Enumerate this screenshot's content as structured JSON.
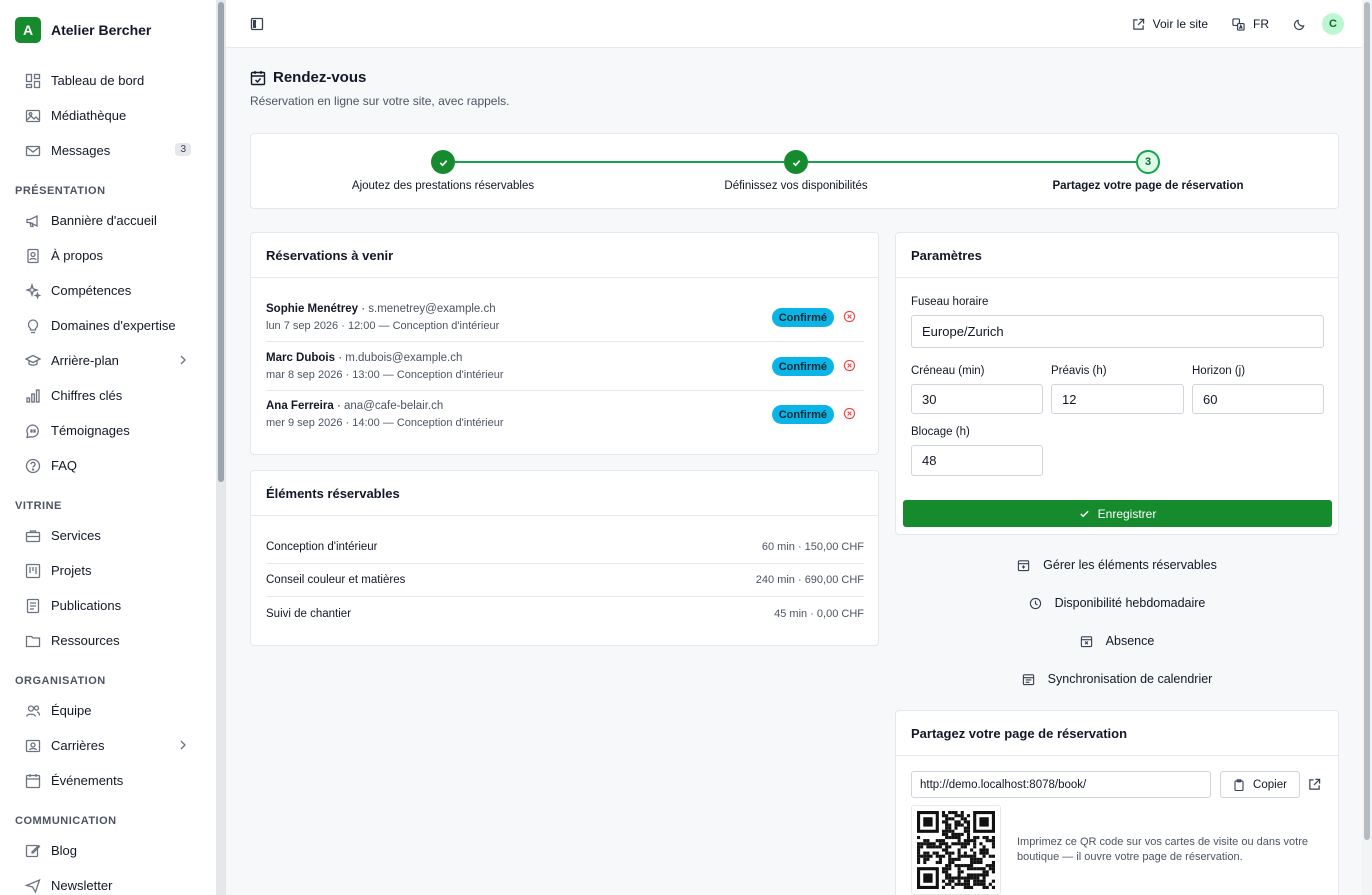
{
  "brand": {
    "initial": "A",
    "name": "Atelier Bercher"
  },
  "sidebar": {
    "items_main": [
      {
        "label": "Tableau de bord",
        "icon": "dashboard-icon"
      },
      {
        "label": "Médiathèque",
        "icon": "image-icon"
      },
      {
        "label": "Messages",
        "icon": "mail-icon",
        "badge": "3"
      }
    ],
    "section_presentation": "PRÉSENTATION",
    "items_presentation": [
      {
        "label": "Bannière d'accueil",
        "icon": "megaphone-icon"
      },
      {
        "label": "À propos",
        "icon": "contact-icon"
      },
      {
        "label": "Compétences",
        "icon": "sparkles-icon"
      },
      {
        "label": "Domaines d'expertise",
        "icon": "lightbulb-icon"
      },
      {
        "label": "Arrière-plan",
        "icon": "graduation-icon",
        "chevron": true
      },
      {
        "label": "Chiffres clés",
        "icon": "bar-chart-icon"
      },
      {
        "label": "Témoignages",
        "icon": "quote-icon"
      },
      {
        "label": "FAQ",
        "icon": "help-icon"
      }
    ],
    "section_vitrine": "VITRINE",
    "items_vitrine": [
      {
        "label": "Services",
        "icon": "briefcase-icon"
      },
      {
        "label": "Projets",
        "icon": "kanban-icon"
      },
      {
        "label": "Publications",
        "icon": "document-icon"
      },
      {
        "label": "Ressources",
        "icon": "folder-icon"
      }
    ],
    "section_organisation": "ORGANISATION",
    "items_organisation": [
      {
        "label": "Équipe",
        "icon": "users-icon"
      },
      {
        "label": "Carrières",
        "icon": "id-card-icon",
        "chevron": true
      },
      {
        "label": "Événements",
        "icon": "calendar-icon"
      }
    ],
    "section_communication": "COMMUNICATION",
    "items_communication": [
      {
        "label": "Blog",
        "icon": "pen-icon"
      },
      {
        "label": "Newsletter",
        "icon": "send-icon"
      }
    ]
  },
  "topbar": {
    "view_site": "Voir le site",
    "language": "FR",
    "avatar": "C"
  },
  "page": {
    "title": "Rendez-vous",
    "subtitle": "Réservation en ligne sur votre site, avec rappels."
  },
  "stepper": {
    "steps": [
      {
        "label": "Ajoutez des prestations réservables",
        "state": "done"
      },
      {
        "label": "Définissez vos disponibilités",
        "state": "done"
      },
      {
        "label": "Partagez votre page de réservation",
        "state": "current",
        "number": "3"
      }
    ]
  },
  "reservations": {
    "title": "Réservations à venir",
    "rows": [
      {
        "name": "Sophie Menétrey",
        "email": "s.menetrey@example.ch",
        "meta": "lun 7 sep 2026 · 12:00 — Conception d'intérieur",
        "status": "Confirmé"
      },
      {
        "name": "Marc Dubois",
        "email": "m.dubois@example.ch",
        "meta": "mar 8 sep 2026 · 13:00 — Conception d'intérieur",
        "status": "Confirmé"
      },
      {
        "name": "Ana Ferreira",
        "email": "ana@cafe-belair.ch",
        "meta": "mer 9 sep 2026 · 14:00 — Conception d'intérieur",
        "status": "Confirmé"
      }
    ]
  },
  "bookable": {
    "title": "Éléments réservables",
    "rows": [
      {
        "name": "Conception d'intérieur",
        "detail": "60 min · 150,00 CHF"
      },
      {
        "name": "Conseil couleur et matières",
        "detail": "240 min · 690,00 CHF"
      },
      {
        "name": "Suivi de chantier",
        "detail": "45 min · 0,00 CHF"
      }
    ]
  },
  "params": {
    "title": "Paramètres",
    "timezone_label": "Fuseau horaire",
    "timezone_value": "Europe/Zurich",
    "slot_label": "Créneau (min)",
    "slot_value": "30",
    "notice_label": "Préavis (h)",
    "notice_value": "12",
    "horizon_label": "Horizon (j)",
    "horizon_value": "60",
    "block_label": "Blocage (h)",
    "block_value": "48",
    "save_label": "Enregistrer"
  },
  "links": {
    "manage": "Gérer les éléments réservables",
    "weekly": "Disponibilité hebdomadaire",
    "absence": "Absence",
    "sync": "Synchronisation de calendrier"
  },
  "share": {
    "title": "Partagez votre page de réservation",
    "url": "http://demo.localhost:8078/book/",
    "copy_label": "Copier",
    "qr_text": "Imprimez ce QR code sur vos cartes de visite ou dans votre boutique — il ouvre votre page de réservation."
  },
  "colors": {
    "accent": "#168b2d",
    "status_confirmed": "#0ab5e6",
    "danger": "#ef4444"
  }
}
